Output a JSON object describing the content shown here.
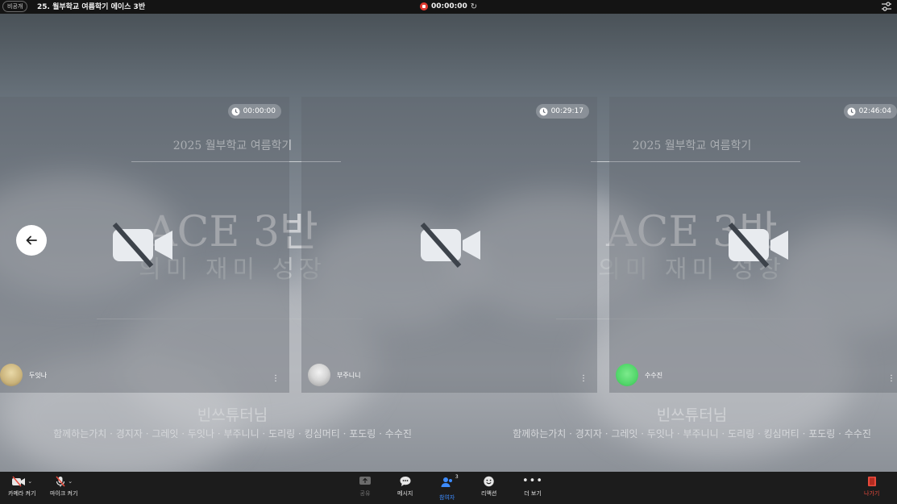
{
  "header": {
    "badge": "비공개",
    "title": "25. 월부학교 여름학기 에이스 3반",
    "recording_time": "00:00:00"
  },
  "background": {
    "subtitle": "2025 월부학교 여름학기",
    "title": "ACE 3반",
    "motto": "의미 재미 성장",
    "team": "빈쓰튜터님",
    "members": "함께하는가치 · 경지자 · 그레잇 · 두잇나 · 부주니니 · 도리링 · 킹심머티 · 포도링 · 수수진"
  },
  "tiles": [
    {
      "name": "두잇나",
      "timer": "00:00:00",
      "avatar_color": "#c9b27a"
    },
    {
      "name": "부주니니",
      "timer": "00:29:17",
      "avatar_color": "#c4c4c4"
    },
    {
      "name": "수수진",
      "timer": "02:46:04",
      "avatar_color": "#52d66a"
    }
  ],
  "toolbar": {
    "camera": "카메라 켜기",
    "mic": "마이크 켜기",
    "share": "공유",
    "messages": "메시지",
    "participants": "참여자",
    "participants_count": "3",
    "reactions": "리액션",
    "more": "더 보기",
    "leave": "나가기"
  },
  "colors": {
    "accent": "#3d8cff",
    "leave": "#e84a3c",
    "record": "#e0392f"
  }
}
